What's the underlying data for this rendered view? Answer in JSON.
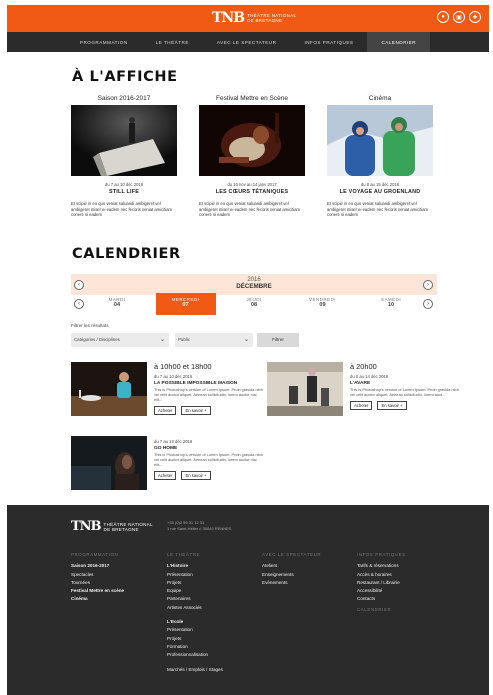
{
  "header": {
    "logo_mark": "TNB",
    "logo_line1": "THÉÂTRE NATIONAL",
    "logo_line2": "DE BRETAGNE",
    "icons": [
      "user-icon",
      "ticket-icon",
      "bookmark-icon"
    ],
    "nav": [
      "PROGRAMMATION",
      "LE THÉÂTRE",
      "AVEC LE SPECTATEUR",
      "INFOS PRATIQUES",
      "CALENDRIER"
    ],
    "active_nav": "CALENDRIER",
    "accent": "#f05a14"
  },
  "affiche": {
    "title": "À L'AFFICHE",
    "cards": [
      {
        "category": "Saison 2016-2017",
        "date": "du 7 au 10 déc 2016",
        "title": "STILL LIFE",
        "desc": "Et scipie in eo quo veniat saluandi ambigeret vel ambigeret miser ei eadem nec fecoris veniat amicitiam conere si eadem"
      },
      {
        "category": "Festival Mettre en Scène",
        "date": "du 16 nov au 14 janv 2017",
        "title": "LES CŒURS TÉTANIQUES",
        "desc": "Et scipie in eo quo veniat saluandi ambigeret vel ambigeret miser ei eadem nec fecoris veniat amicitiam conere si eadem"
      },
      {
        "category": "Cinéma",
        "date": "du 8 au 15 déc 2016",
        "title": "LE VOYAGE AU GROENLAND",
        "desc": "Et scipie in eo quo veniat saluandi ambigeret vel ambigeret miser ei eadem nec fecoris veniat amicitiam conere si eadem"
      }
    ]
  },
  "calendar": {
    "title": "CALENDRIER",
    "year": "2016",
    "month": "DÉCEMBRE",
    "days": [
      {
        "name": "MARDI",
        "num": "04"
      },
      {
        "name": "MERCREDI",
        "num": "07"
      },
      {
        "name": "JEUDI",
        "num": "08"
      },
      {
        "name": "VENDREDI",
        "num": "09"
      },
      {
        "name": "SAMEDI",
        "num": "10"
      }
    ],
    "active_day": "07",
    "filter_label": "Filtrer les résultats",
    "select_category": "Catégories / Disciplines",
    "select_public": "Public",
    "filter_button": "Filtrer"
  },
  "events": [
    {
      "time": "à 10h00 et 18h00",
      "date": "du 7 au 10 déc 2016",
      "title": "LA POSSIBLE IMPOSSIBLE MAISON",
      "desc": "This is Photoshop's version of Lorem Ipsum. Proin gravida nibh vel velit auctor aliquet. Aenean sollicitudin, lorem auctor nisi elit...",
      "buy": "Acheter",
      "more": "En savoir +"
    },
    {
      "time": "à 20h00",
      "date": "du 5 au 14 déc 2016",
      "title": "L'AVARE",
      "desc": "This is Photoshop's version of Lorem Ipsum. Proin gravida nibh vel velit auctor aliquet. Aenean sollicitudin, lorem auct...",
      "buy": "Acheter",
      "more": "En savoir +"
    },
    {
      "time": "",
      "date": "du 7 au 13 déc 2016",
      "title": "GO HOME",
      "desc": "This is Photoshop's version of Lorem Ipsum. Proin gravida nibh vel velit auctor aliquet. Aenean sollicitudin, lorem auctor nisi elit...",
      "buy": "Acheter",
      "more": "En savoir +"
    }
  ],
  "footer": {
    "logo_mark": "TNB",
    "logo_line1": "THÉÂTRE NATIONAL",
    "logo_line2": "DE BRETAGNE",
    "phone": "+33 (0)2 99 31 12 31",
    "address": "1 rue Saint-Hélier // 35040 RENNES",
    "col1_head": "PROGRAMMATION",
    "col1": [
      "Saison 2016-2017",
      "Spectacles",
      "Tournées",
      "Festival Mettre en scène",
      "Cinéma"
    ],
    "col2_head": "LE THÉÂTRE",
    "col2": [
      "L'Histoire",
      "Présentation",
      "Projets",
      "Equipe",
      "Partenaires",
      "Artistes Associés"
    ],
    "col2b": [
      "L'Ecole",
      "Présentation",
      "Projets",
      "Formation",
      "Professionnalisation"
    ],
    "col2c": "Marchés / Emplois / Stages",
    "col3_head": "AVEC LE SPECTATEUR",
    "col3": [
      "Ateliers",
      "Enseignements",
      "Evènements"
    ],
    "col4_head": "INFOS PRATIQUES",
    "col4": [
      "Tarifs & réservations",
      "Accès & horaires",
      "Restaurant / Librairie",
      "Accessibilité",
      "Contacts"
    ],
    "col4_sub": "CALENDRIER"
  }
}
